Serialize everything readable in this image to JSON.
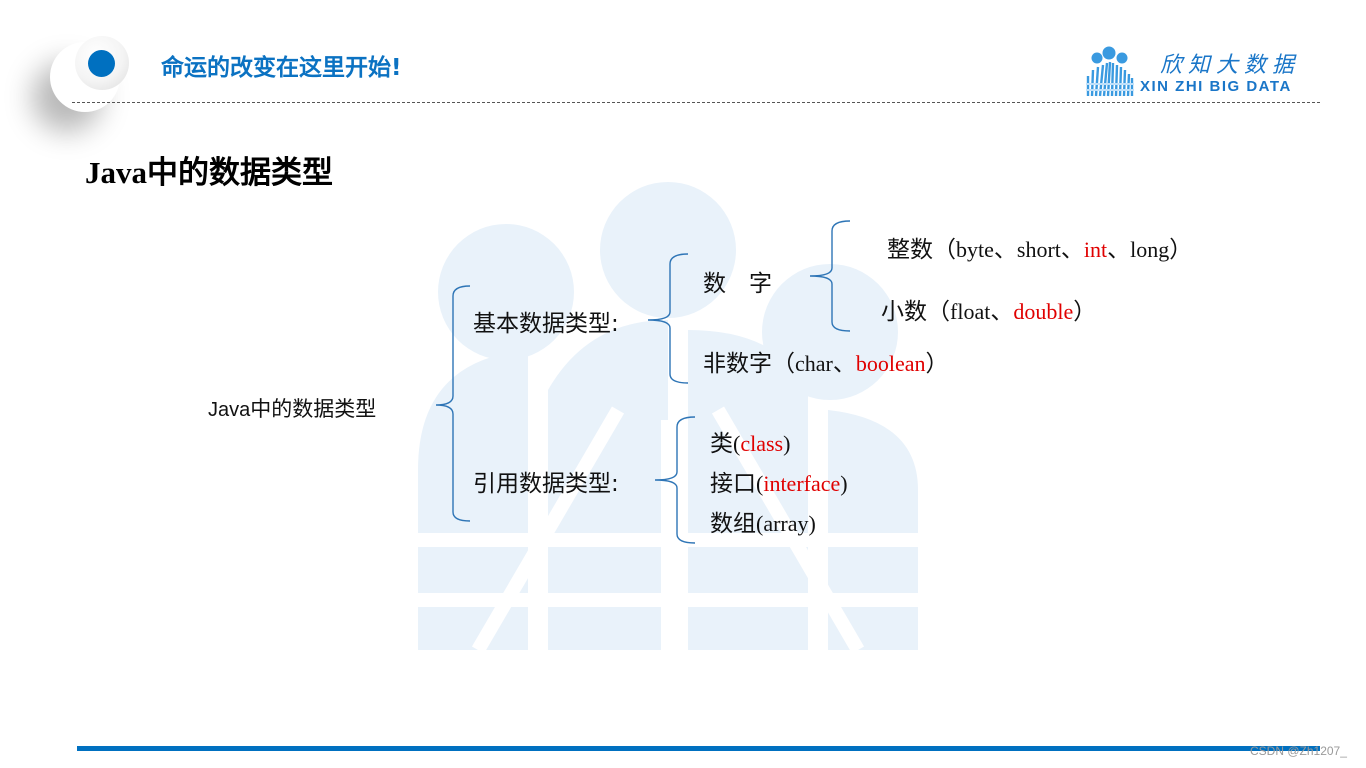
{
  "header": {
    "slogan": "命运的改变在这里开始!",
    "logo": {
      "chinese": "欣知大数据",
      "english": "XIN ZHI BIG DATA",
      "icon": "people-sunburst-logo-icon",
      "color": "#1a76c8"
    },
    "bullet_icon": "blue-dot-bullet-icon",
    "accent_color": "#0070c0"
  },
  "page_title": {
    "latin": "Java",
    "cjk": "中的数据类型"
  },
  "diagram": {
    "root": {
      "latin": "Java",
      "cjk": "中的数据类型"
    },
    "primitive": {
      "label": "基本数据类型:",
      "numeric": {
        "label": "数　字",
        "integer": {
          "label": "整数",
          "open": "（",
          "items": [
            {
              "text": "byte",
              "highlight": false
            },
            {
              "text": "short",
              "highlight": false
            },
            {
              "text": "int",
              "highlight": true
            },
            {
              "text": "long",
              "highlight": false
            }
          ],
          "separator": "、",
          "close": "）"
        },
        "decimal": {
          "label": "小数",
          "open": "（",
          "items": [
            {
              "text": "float",
              "highlight": false
            },
            {
              "text": "double",
              "highlight": true
            }
          ],
          "separator": "、",
          "close": "）"
        }
      },
      "non_numeric": {
        "label": "非数字",
        "open": "（",
        "items": [
          {
            "text": "char",
            "highlight": false
          },
          {
            "text": "boolean",
            "highlight": true
          }
        ],
        "separator": "、",
        "close": "）"
      }
    },
    "reference": {
      "label": "引用数据类型:",
      "items": [
        {
          "label": "类",
          "open": "(",
          "en": "class",
          "close": ")",
          "highlight": true
        },
        {
          "label": "接口",
          "open": "(",
          "en": "interface",
          "close": ")",
          "highlight": true
        },
        {
          "label": "数组",
          "open": "(",
          "en": "array",
          "close": ")",
          "highlight": false
        }
      ]
    },
    "highlight_color": "#e00000",
    "brace_color": "#2e75b6"
  },
  "footer": {
    "watermark": "CSDN @Zh1207_"
  }
}
